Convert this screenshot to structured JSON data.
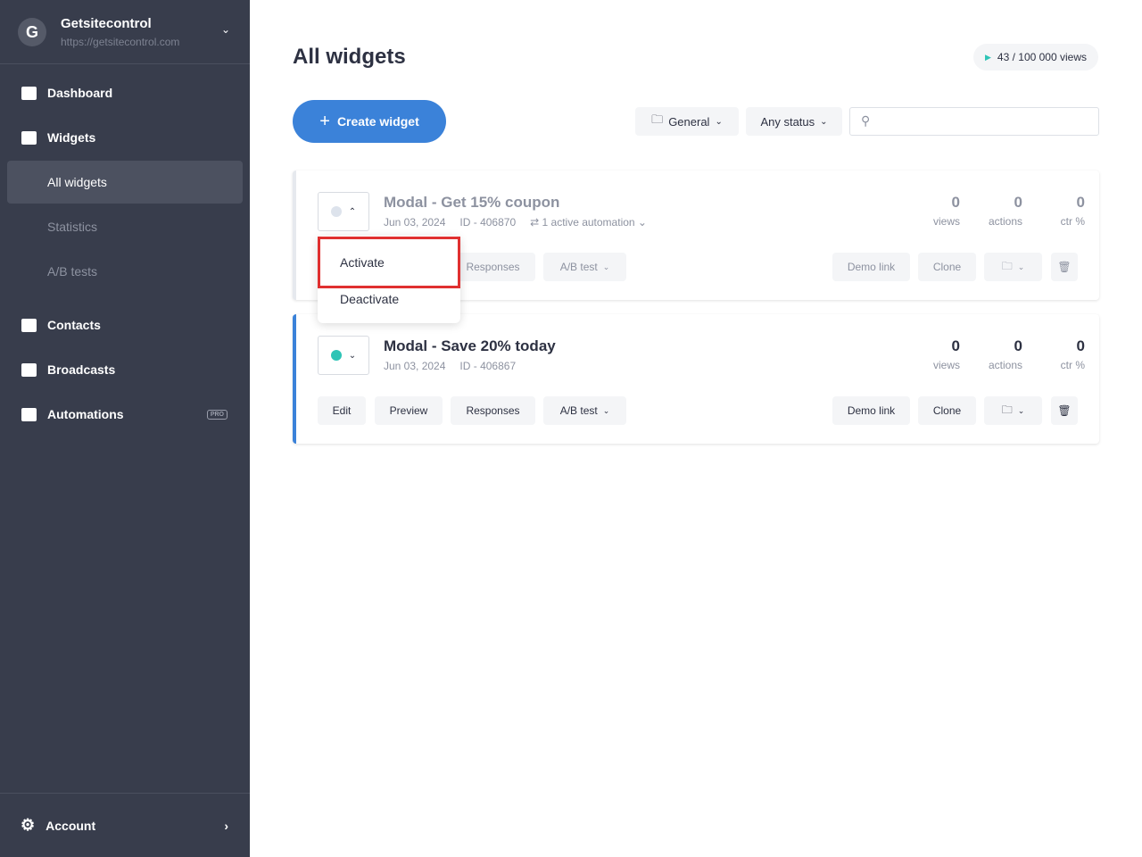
{
  "brand": {
    "name": "Getsitecontrol",
    "url": "https://getsitecontrol.com"
  },
  "sidebar": {
    "items": [
      {
        "label": "Dashboard"
      },
      {
        "label": "Widgets"
      },
      {
        "label": "Contacts"
      },
      {
        "label": "Broadcasts"
      },
      {
        "label": "Automations",
        "badge": "PRO"
      }
    ],
    "subitems": [
      {
        "label": "All widgets"
      },
      {
        "label": "Statistics"
      },
      {
        "label": "A/B tests"
      }
    ],
    "account": "Account"
  },
  "header": {
    "title": "All widgets",
    "views": "43 / 100 000 views"
  },
  "toolbar": {
    "create": "Create widget",
    "folder": "General",
    "status": "Any status",
    "search_placeholder": ""
  },
  "widgets": [
    {
      "name": "Modal - Get 15% coupon",
      "date": "Jun 03, 2024",
      "id": "ID - 406870",
      "automation": "1 active automation",
      "views": "0",
      "actions": "0",
      "ctr": "0",
      "status_color": "#dde3ec"
    },
    {
      "name": "Modal - Save 20% today",
      "date": "Jun 03, 2024",
      "id": "ID - 406867",
      "views": "0",
      "actions": "0",
      "ctr": "0",
      "status_color": "#2ec4b6"
    }
  ],
  "labels": {
    "views": "views",
    "actions": "actions",
    "ctr": "ctr %",
    "edit": "Edit",
    "preview": "Preview",
    "responses": "Responses",
    "ab": "A/B test",
    "demo": "Demo link",
    "clone": "Clone"
  },
  "menu": {
    "activate": "Activate",
    "deactivate": "Deactivate"
  }
}
